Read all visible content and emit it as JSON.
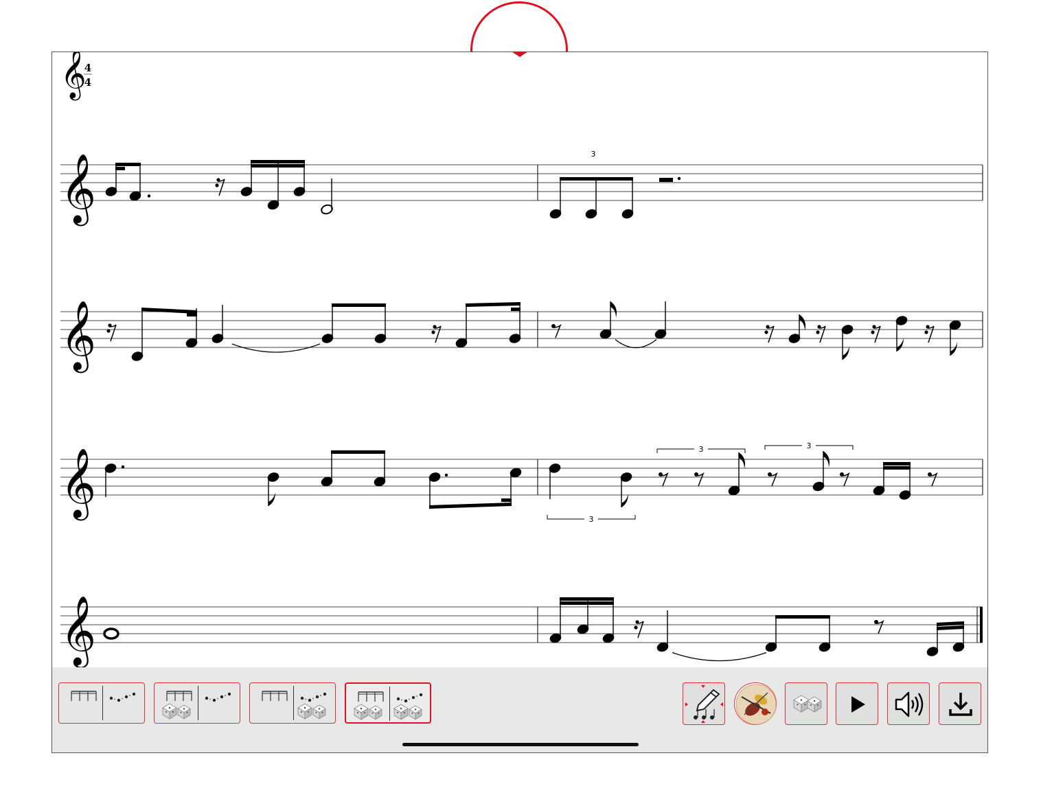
{
  "score": {
    "time_signature": {
      "numerator": "4",
      "denominator": "4"
    },
    "tuplet_label": "3",
    "systems": 4
  },
  "toolbar": {
    "mode_buttons": [
      {
        "name": "rhythm-only",
        "rhythm_dice": false,
        "pitch_dice": false,
        "active": false
      },
      {
        "name": "random-rhythm",
        "rhythm_dice": true,
        "pitch_dice": false,
        "active": false
      },
      {
        "name": "random-pitch",
        "rhythm_dice": false,
        "pitch_dice": true,
        "active": false
      },
      {
        "name": "random-rhythm-and-pitch",
        "rhythm_dice": true,
        "pitch_dice": true,
        "active": true
      }
    ],
    "tool_buttons": [
      {
        "name": "edit-notes",
        "icon": "pen-notes-icon"
      },
      {
        "name": "instrument",
        "icon": "instruments-icon"
      },
      {
        "name": "dice",
        "icon": "dice-icon"
      },
      {
        "name": "play",
        "icon": "play-icon"
      },
      {
        "name": "volume",
        "icon": "speaker-icon"
      },
      {
        "name": "export",
        "icon": "download-icon"
      }
    ]
  },
  "colors": {
    "accent": "#e0101e",
    "toolbar_bg": "#e8e8e8",
    "ink": "#000000"
  }
}
